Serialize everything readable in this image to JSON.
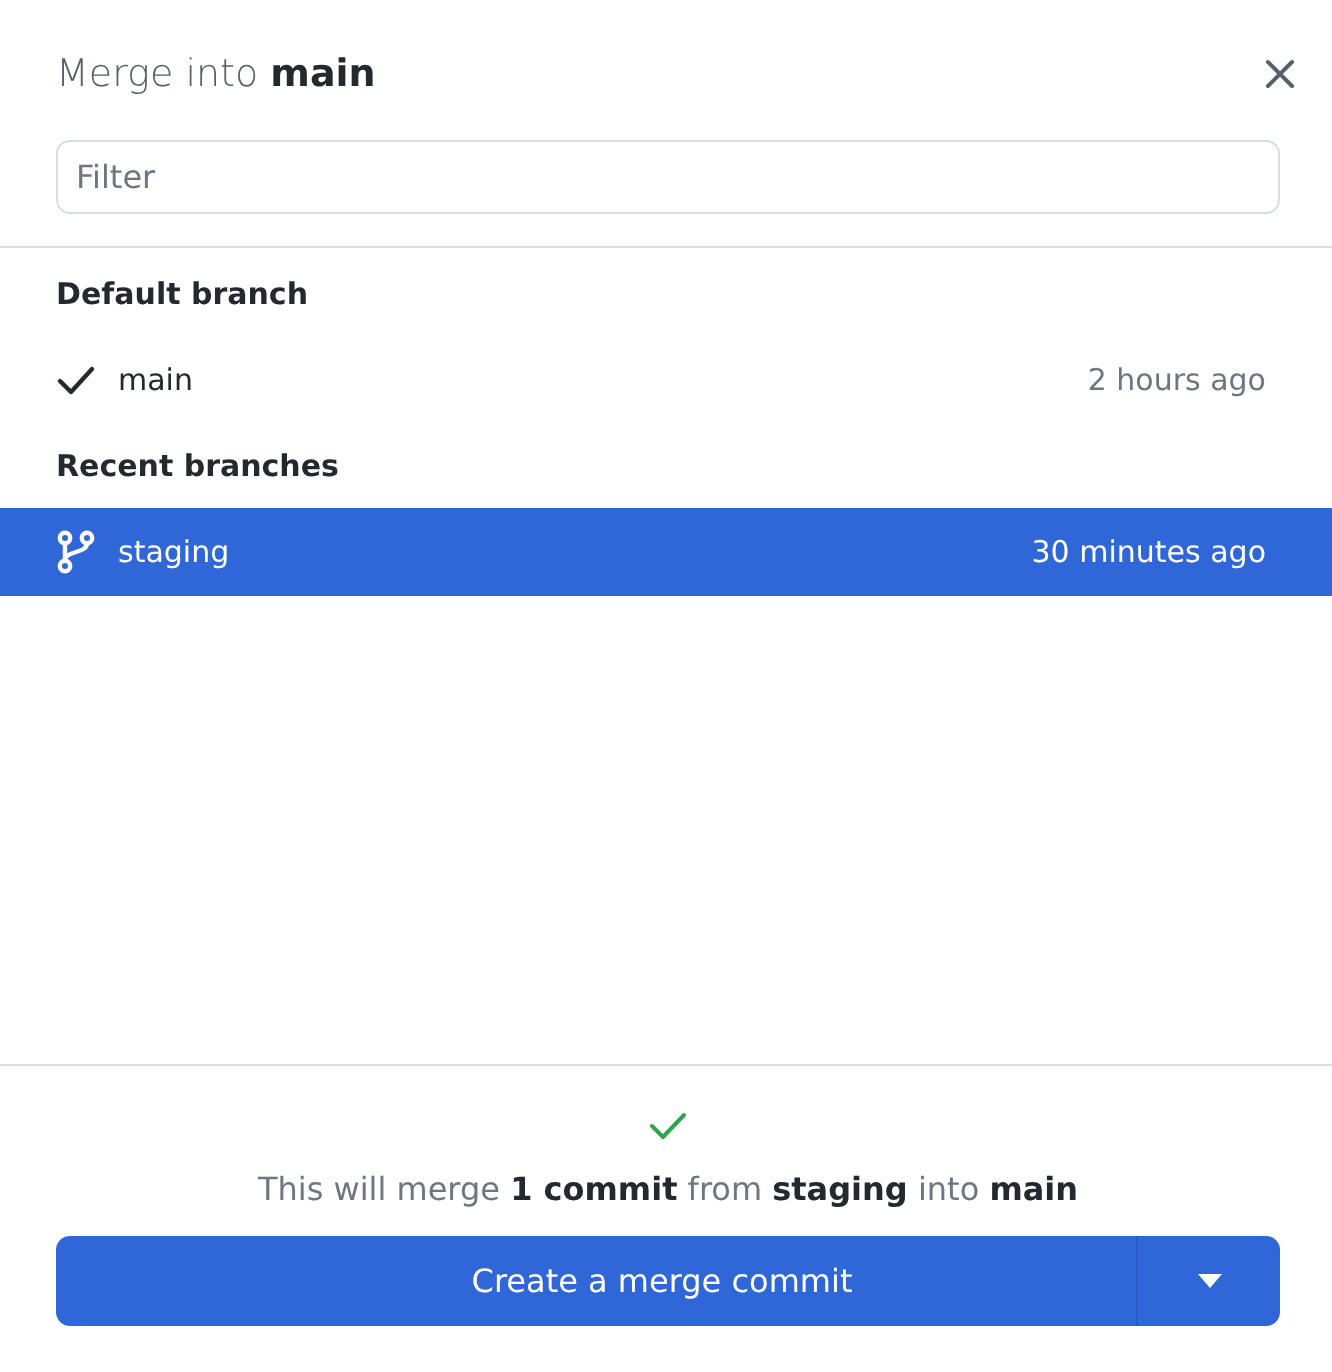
{
  "title": "Merge into **main**",
  "filter": {
    "placeholder": "Filter"
  },
  "groups": [
    {
      "heading": "Default branch",
      "items": [
        {
          "kind": "check",
          "name": "main",
          "time": "2 hours ago",
          "selected": false
        }
      ]
    },
    {
      "heading": "Recent branches",
      "items": [
        {
          "kind": "branch",
          "name": "staging",
          "time": "30 minutes ago",
          "selected": true
        }
      ]
    }
  ],
  "summary": "This will merge **1 commit** from **staging** into **main**",
  "merge_button": {
    "label": "Create a merge commit"
  }
}
